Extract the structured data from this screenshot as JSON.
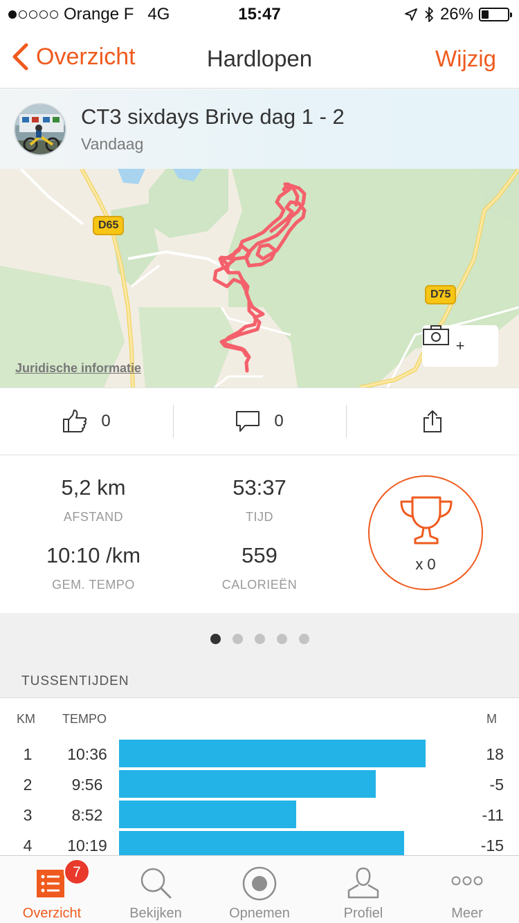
{
  "status_bar": {
    "carrier": "Orange F",
    "network": "4G",
    "time": "15:47",
    "battery": "26%",
    "battery_level": 0.26,
    "signal_bars": 1
  },
  "nav": {
    "back_label": "Overzicht",
    "title": "Hardlopen",
    "edit_label": "Wijzig"
  },
  "activity": {
    "title": "CT3 sixdays Brive dag 1 - 2",
    "date": "Vandaag"
  },
  "map": {
    "roads": [
      "D65",
      "D75"
    ],
    "legal_link": "Juridische informatie",
    "add_photo_label": "+"
  },
  "social": {
    "likes": "0",
    "comments": "0"
  },
  "stats": {
    "distance": {
      "value": "5,2 km",
      "label": "AFSTAND"
    },
    "time": {
      "value": "53:37",
      "label": "TIJD"
    },
    "pace": {
      "value": "10:10 /km",
      "label": "GEM. TEMPO"
    },
    "calories": {
      "value": "559",
      "label": "CALORIEËN"
    },
    "trophies": "x 0"
  },
  "pager": {
    "count": 5,
    "active": 0
  },
  "splits": {
    "title": "TUSSENTIJDEN",
    "headers": {
      "km": "KM",
      "tempo": "TEMPO",
      "m": "M"
    },
    "rows": [
      {
        "km": "1",
        "tempo": "10:36",
        "pace_sec": 636,
        "m": "18"
      },
      {
        "km": "2",
        "tempo": "9:56",
        "pace_sec": 596,
        "m": "-5"
      },
      {
        "km": "3",
        "tempo": "8:52",
        "pace_sec": 532,
        "m": "-11"
      },
      {
        "km": "4",
        "tempo": "10:19",
        "pace_sec": 619,
        "m": "-15"
      }
    ]
  },
  "tabbar": {
    "items": [
      {
        "label": "Overzicht",
        "icon": "list-icon",
        "active": true,
        "badge": "7"
      },
      {
        "label": "Bekijken",
        "icon": "search-icon",
        "active": false
      },
      {
        "label": "Opnemen",
        "icon": "record-icon",
        "active": false
      },
      {
        "label": "Profiel",
        "icon": "profile-icon",
        "active": false
      },
      {
        "label": "Meer",
        "icon": "more-icon",
        "active": false
      }
    ]
  },
  "colors": {
    "accent": "#ef5a1e",
    "split_bar": "#23b3e7",
    "route": "#f4606b",
    "badge": "#e8392b"
  }
}
